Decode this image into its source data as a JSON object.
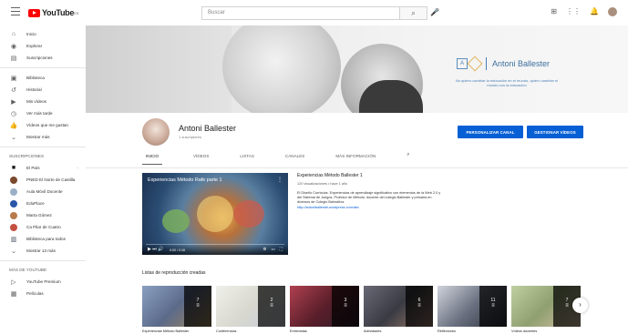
{
  "header": {
    "logo_text": "YouTube",
    "logo_region": "ES",
    "search_placeholder": "Buscar"
  },
  "sidebar": {
    "main_items": [
      {
        "label": "Inicio",
        "icon": "home-icon"
      },
      {
        "label": "Explorar",
        "icon": "explore-icon"
      },
      {
        "label": "Suscripciones",
        "icon": "subscriptions-icon"
      }
    ],
    "library_items": [
      {
        "label": "Biblioteca",
        "icon": "library-icon"
      },
      {
        "label": "Historial",
        "icon": "history-icon"
      },
      {
        "label": "Mis vídeos",
        "icon": "your-videos-icon"
      },
      {
        "label": "Ver más tarde",
        "icon": "watch-later-icon"
      },
      {
        "label": "Vídeos que me gustan",
        "icon": "liked-icon"
      },
      {
        "label": "Mostrar más",
        "icon": "chevron-down-icon"
      }
    ],
    "subscriptions_heading": "Suscripciones",
    "subscriptions": [
      {
        "label": "El País",
        "color": "#1a1a1a"
      },
      {
        "label": "PNED El Norte de Castilla",
        "color": "#7a4a2e"
      },
      {
        "label": "Aula Móvil Docente",
        "color": "#9ab0c8"
      },
      {
        "label": "EduPlace",
        "color": "#2a56a8"
      },
      {
        "label": "Marta Gómez",
        "color": "#b87a4a"
      },
      {
        "label": "Ca Pilar de Cuatro",
        "color": "#c45040"
      },
      {
        "label": "Biblioteca para todos",
        "color": "#404a5a"
      },
      {
        "label": "Mostrar 13 más",
        "color": "#ffffff"
      }
    ],
    "more_heading": "Más de YouTube",
    "more_items": [
      {
        "label": "YouTube Premium",
        "icon": "premium-icon"
      },
      {
        "label": "Películas",
        "icon": "movies-icon"
      }
    ]
  },
  "banner": {
    "brand_logo_letters": "A",
    "brand_name": "Antoni Ballester",
    "tagline": "No quiero cambiar la educación en el mundo, quiero cambiar el mundo con la educación"
  },
  "channel": {
    "name": "Antoni Ballester",
    "subscribers": "1 suscriptores",
    "customize_button": "PERSONALIZAR CANAL",
    "manage_button": "GESTIONAR VÍDEOS",
    "tabs": [
      "INICIO",
      "VÍDEOS",
      "LISTAS",
      "CANALES",
      "MÁS INFORMACIÓN"
    ]
  },
  "featured_video": {
    "overlay_title": "Experiencias Método Rafe parte 1",
    "time": "0:00 / 2:16",
    "title": "Experiencias Método Ballester 1",
    "meta": "120 visualizaciones • hace 1 año",
    "description": "El Diseño Curricular. Experiencias de aprendizaje significativo con elementos de la Web 2.0 y del Sistema de Juegos. Profesor de Método: docente del colegio Ballester y primaria en diversos de Colegio Balmaños.",
    "link": "http://antoniballester.wordpress.com/abc"
  },
  "playlists": {
    "heading": "Listas de reproducción creadas",
    "items": [
      {
        "count": "7",
        "caption": "Experiencias Método Ballester",
        "bg": "#5c6a8a"
      },
      {
        "count": "2",
        "caption": "Conferencias",
        "bg": "#d8d8d0"
      },
      {
        "count": "3",
        "caption": "Entrevistas",
        "bg": "#5a1f2a"
      },
      {
        "count": "6",
        "caption": "Actividades",
        "bg": "#3a3a42"
      },
      {
        "count": "11",
        "caption": "Reflexiones",
        "bg": "#6a7080"
      },
      {
        "count": "7",
        "caption": "Vídeos docentes",
        "bg": "#8fa070"
      }
    ]
  }
}
